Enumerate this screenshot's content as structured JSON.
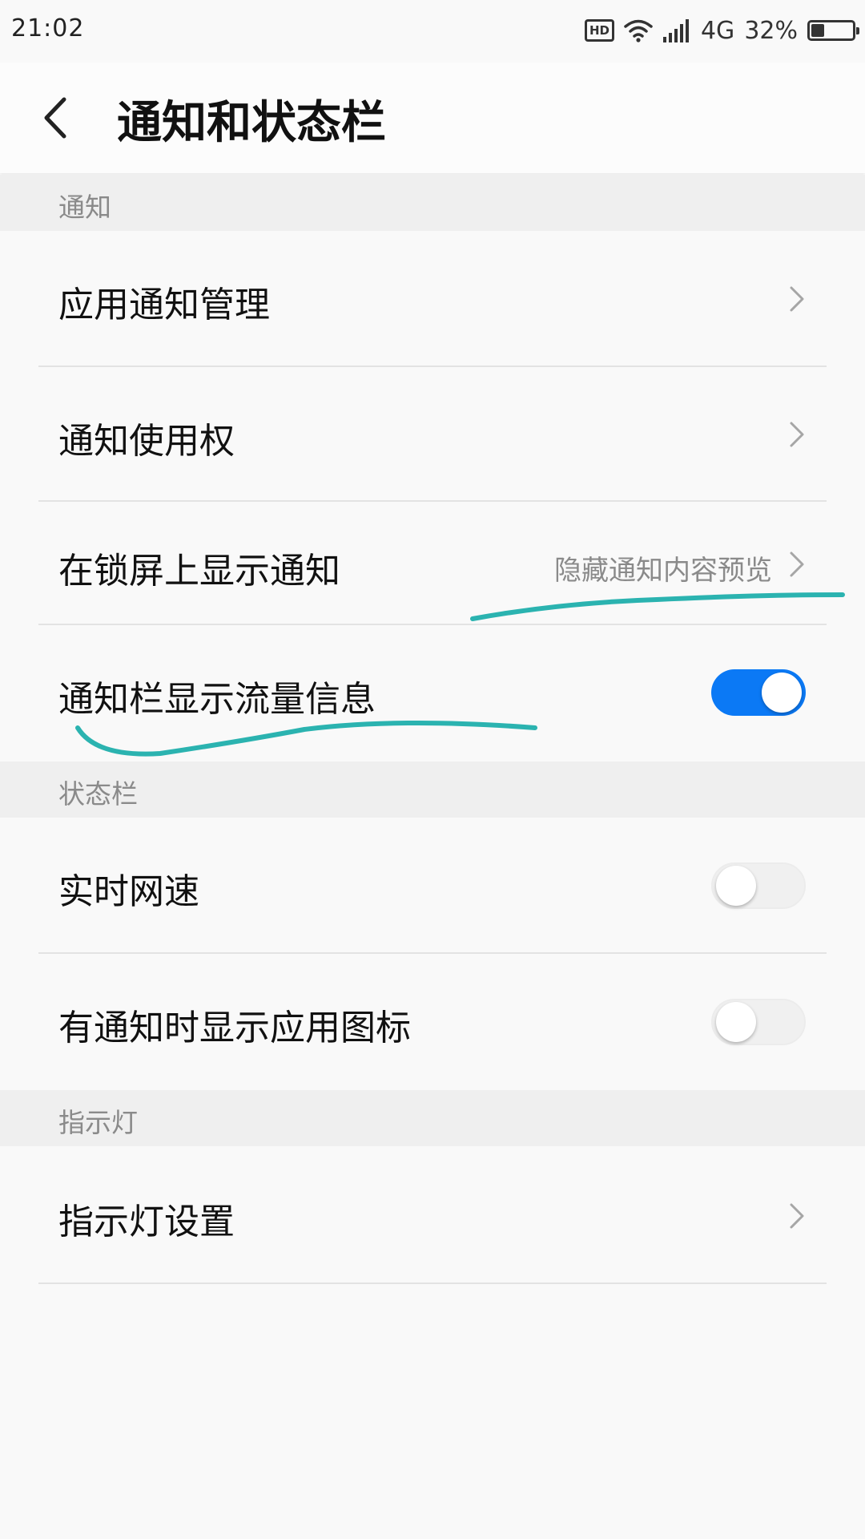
{
  "status_bar": {
    "time": "21:02",
    "hd": "HD",
    "network": "4G",
    "battery_percent": "32%",
    "battery_level": 0.32,
    "icons": [
      "hd-icon",
      "wifi-icon",
      "signal-icon",
      "battery-icon"
    ]
  },
  "header": {
    "title": "通知和状态栏",
    "back_icon": "back-arrow-icon"
  },
  "sections": {
    "notifications": {
      "title": "通知",
      "items": [
        {
          "label": "应用通知管理"
        },
        {
          "label": "通知使用权"
        },
        {
          "label": "在锁屏上显示通知",
          "value": "隐藏通知内容预览"
        },
        {
          "label": "通知栏显示流量信息",
          "toggle": true
        }
      ]
    },
    "status_bar": {
      "title": "状态栏",
      "items": [
        {
          "label": "实时网速",
          "toggle": false
        },
        {
          "label": "有通知时显示应用图标",
          "toggle": false
        }
      ]
    },
    "indicator": {
      "title": "指示灯",
      "items": [
        {
          "label": "指示灯设置"
        }
      ]
    }
  },
  "colors": {
    "accent": "#0b79f5",
    "annotation": "#2bb3b0",
    "section_bg": "#efefef",
    "secondary_text": "#8a8a8a"
  }
}
